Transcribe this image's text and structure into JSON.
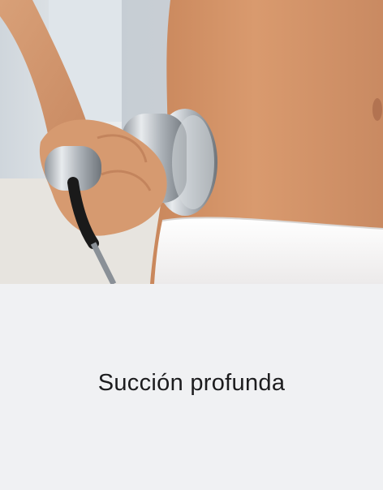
{
  "card": {
    "title": "Succión profunda",
    "image": {
      "subject": "treatment-photo",
      "background_color": "#e9e6e2"
    },
    "caption_background": "#f0f1f3",
    "caption_color": "#1c1c1e"
  }
}
